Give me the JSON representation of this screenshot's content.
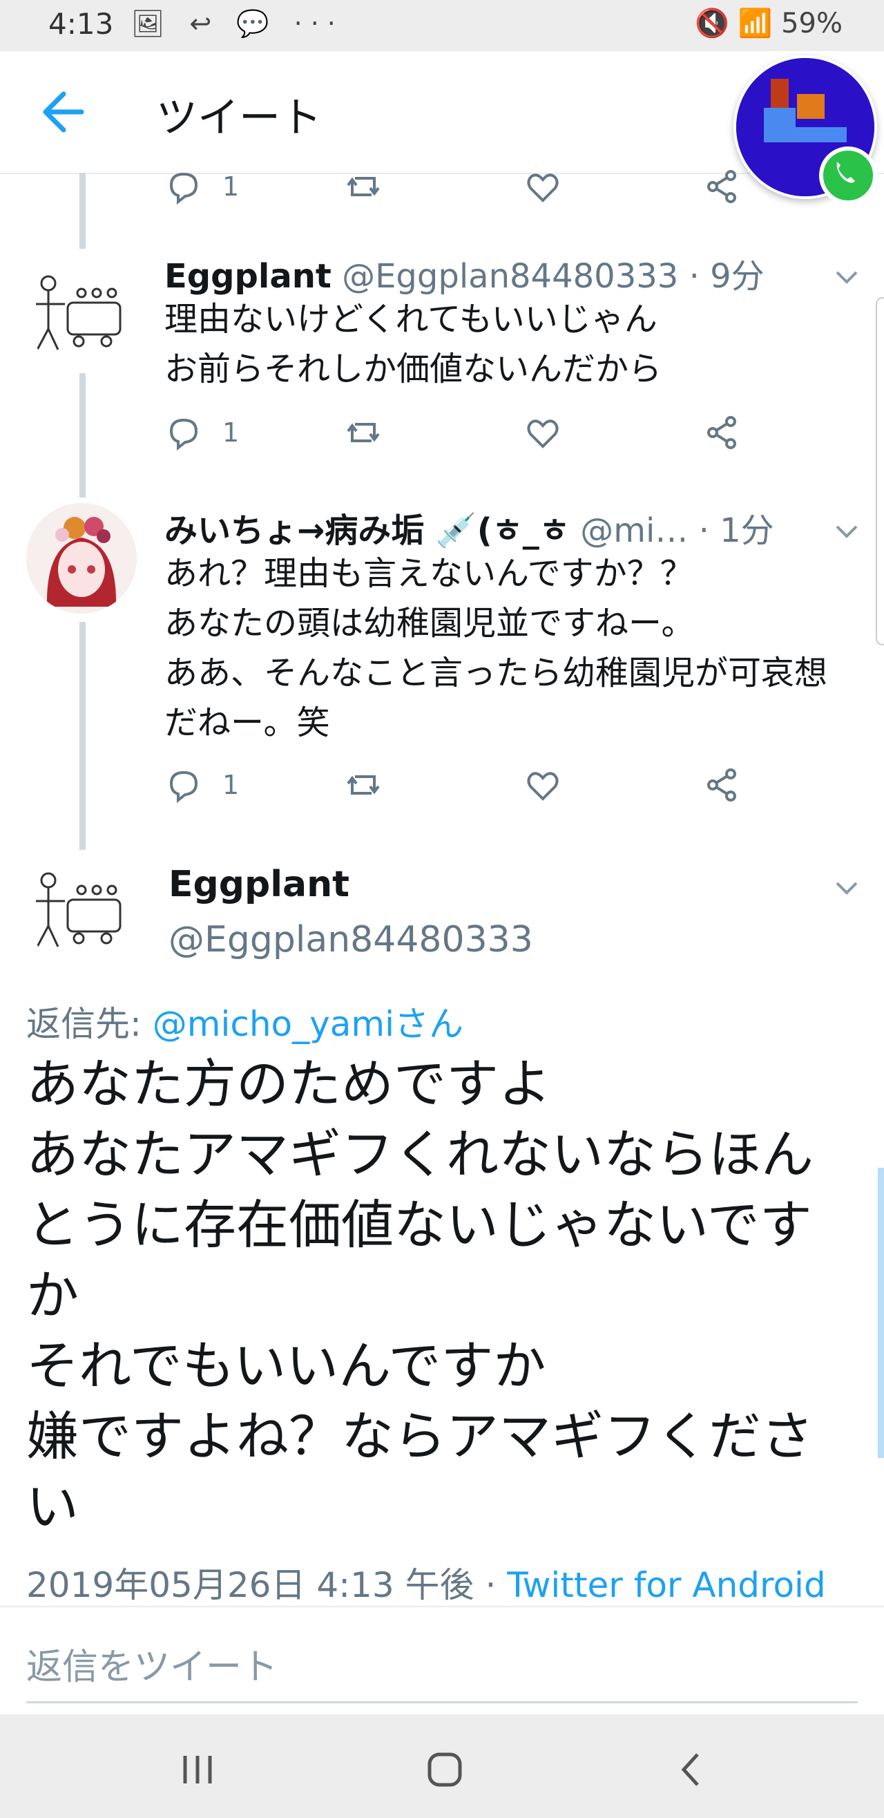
{
  "status_bar": {
    "time": "4:13",
    "left_icons": "🖼 ↩ 💬 ···",
    "right_text": "🔇 📶 59%"
  },
  "app_bar": {
    "title": "ツイート",
    "back_icon": "arrow-left-icon",
    "accent": "#1da1f2"
  },
  "tweets": [
    {
      "reply_count": "1"
    },
    {
      "name": "Eggplant",
      "handle": "@Eggplan84480333",
      "time": "· 9分",
      "text": "理由ないけどくれてもいいじゃん\nお前らそれしか価値ないんだから",
      "reply_count": "1"
    },
    {
      "name": "みいちょ→病み垢 💉(ㅎ_ㅎ",
      "handle": "@mi…",
      "time": "· 1分",
      "text": "あれ？理由も言えないんですか？？\nあなたの頭は幼稚園児並ですねー。\nああ、そんなこと言ったら幼稚園児が可哀想だねー。笑",
      "reply_count": "1"
    }
  ],
  "main_tweet": {
    "name": "Eggplant",
    "handle": "@Eggplan84480333",
    "reply_to_label": "返信先:",
    "reply_to_user": "@micho_yamiさん",
    "text": "あなた方のためですよ\nあなたアマギフくれないならほんとうに存在価値ないじゃないですか\nそれでもいいんですか\n嫌ですよね？ならアマギフください",
    "datetime": "2019年05月26日 4:13 午後 · ",
    "source": "Twitter for Android"
  },
  "reply_box": {
    "placeholder": "返信をツイート"
  }
}
